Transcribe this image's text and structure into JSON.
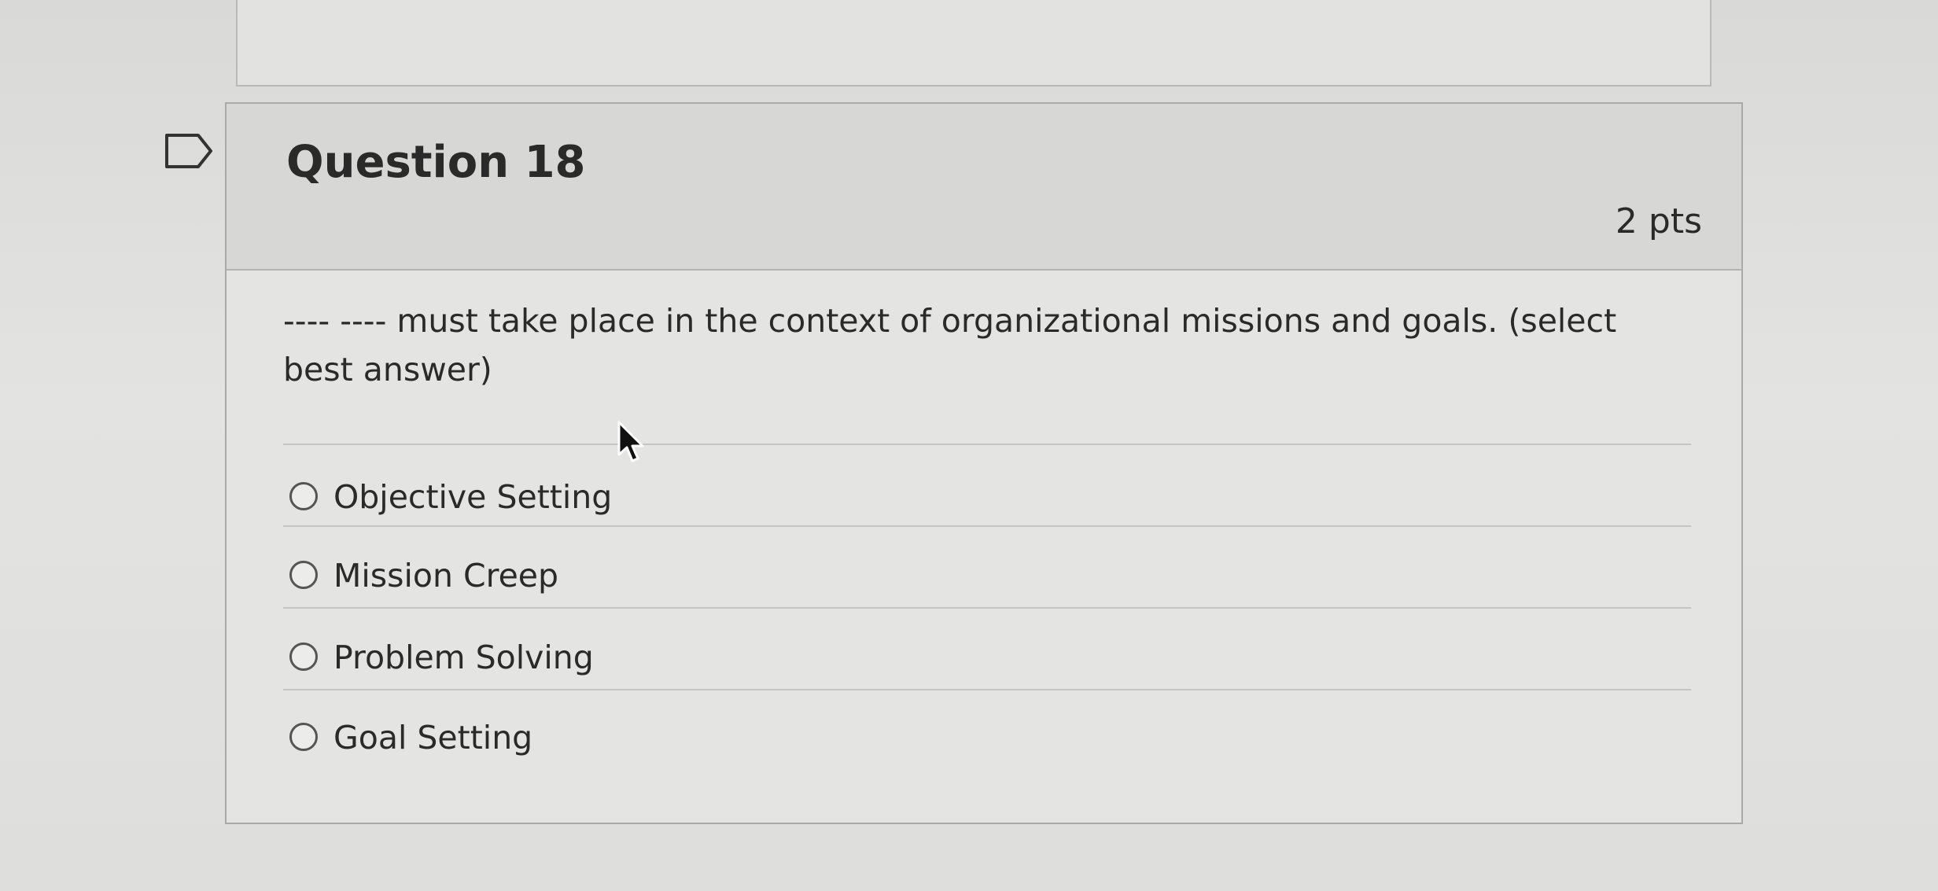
{
  "question": {
    "title": "Question 18",
    "points": "2 pts",
    "text": "---- ---- must take place in the context of organizational missions and goals. (select best answer)",
    "answers": [
      {
        "label": "Objective Setting",
        "selected": false
      },
      {
        "label": "Mission Creep",
        "selected": false
      },
      {
        "label": "Problem Solving",
        "selected": false
      },
      {
        "label": "Goal Setting",
        "selected": false
      }
    ]
  },
  "icons": {
    "flag": "flag-question-icon",
    "cursor": "mouse-pointer-icon"
  },
  "colors": {
    "background": "#dcdcda",
    "card": "#e4e4e2",
    "header": "#d7d7d5",
    "text": "#2a2a2a"
  }
}
